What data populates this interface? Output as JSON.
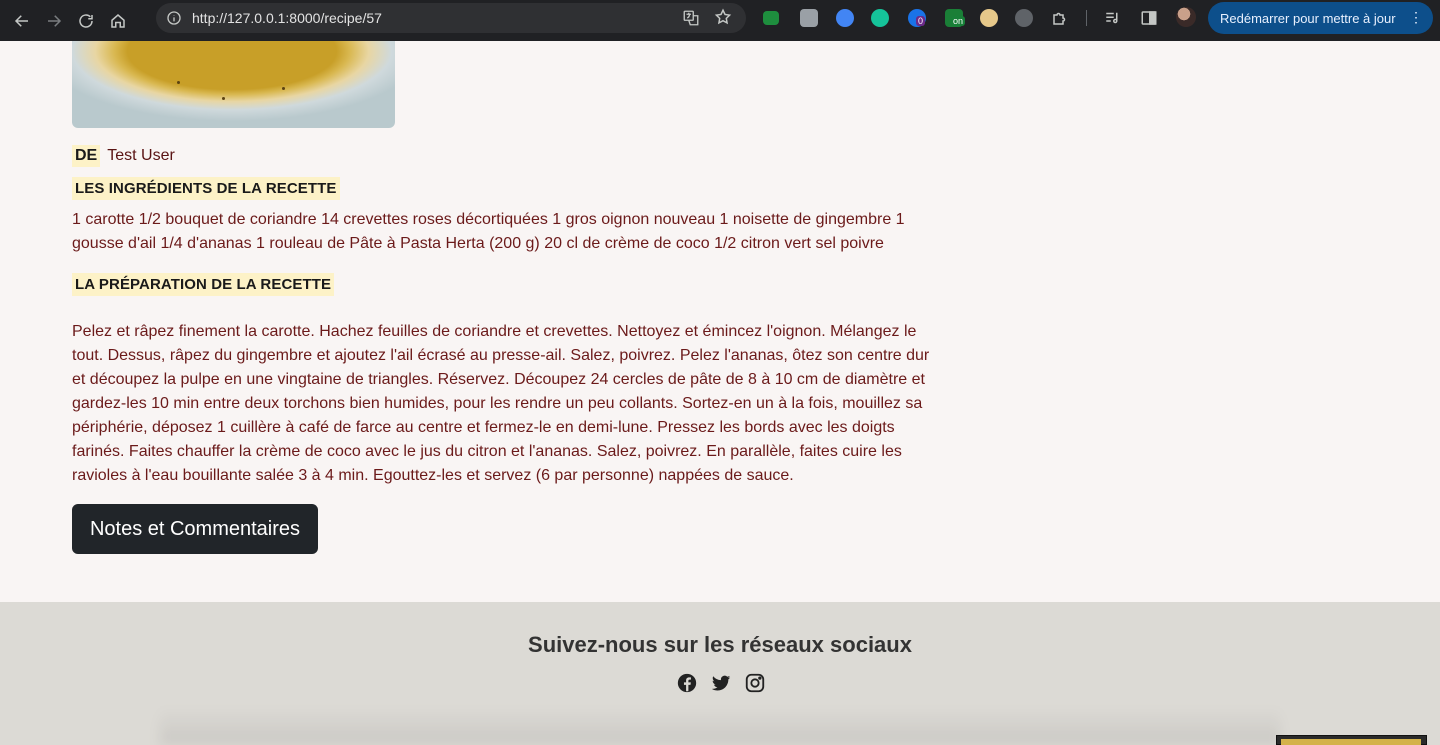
{
  "browser": {
    "url": "http://127.0.0.1:8000/recipe/57",
    "update_button": "Redémarrer pour mettre à jour",
    "extensions": [
      "check-icon",
      "reader-icon",
      "compass-icon",
      "grammarly-icon",
      "notion-icon",
      "onoff-icon",
      "bicycle-icon",
      "gear-icon",
      "puzzle-icon"
    ],
    "extension_badges": {
      "notion": "0",
      "onoff": "on"
    }
  },
  "recipe": {
    "author_label": "DE",
    "author_name": "Test User",
    "ingredients_title": "LES INGRÉDIENTS DE LA RECETTE",
    "ingredients": "1 carotte 1/2 bouquet de coriandre 14 crevettes roses décortiquées 1 gros oignon nouveau 1 noisette de gingembre 1 gousse d'ail 1/4 d'ananas 1 rouleau de Pâte à Pasta Herta (200 g) 20 cl de crème de coco 1/2 citron vert sel poivre",
    "preparation_title": "LA PRÉPARATION DE LA RECETTE",
    "preparation": "Pelez et râpez finement la carotte. Hachez feuilles de coriandre et crevettes. Nettoyez et émincez l'oignon. Mélangez le tout. Dessus, râpez du gingembre et ajoutez l'ail écrasé au presse-ail. Salez, poivrez. Pelez l'ananas, ôtez son centre dur et découpez la pulpe en une vingtaine de triangles. Réservez. Découpez 24 cercles de pâte de 8 à 10 cm de diamètre et gardez-les 10 min entre deux torchons bien humides, pour les rendre un peu collants. Sortez-en un à la fois, mouillez sa périphérie, déposez 1 cuillère à café de farce au centre et fermez-le en demi-lune. Pressez les bords avec les doigts farinés. Faites chauffer la crème de coco avec le jus du citron et l'ananas. Salez, poivrez. En parallèle, faites cuire les ravioles à l'eau bouillante salée 3 à 4 min. Egouttez-les et servez (6 par personne) nappées de sauce.",
    "notes_button": "Notes et Commentaires"
  },
  "footer": {
    "title": "Suivez-nous sur les réseaux sociaux",
    "socials": [
      "facebook-icon",
      "twitter-icon",
      "instagram-icon"
    ]
  }
}
